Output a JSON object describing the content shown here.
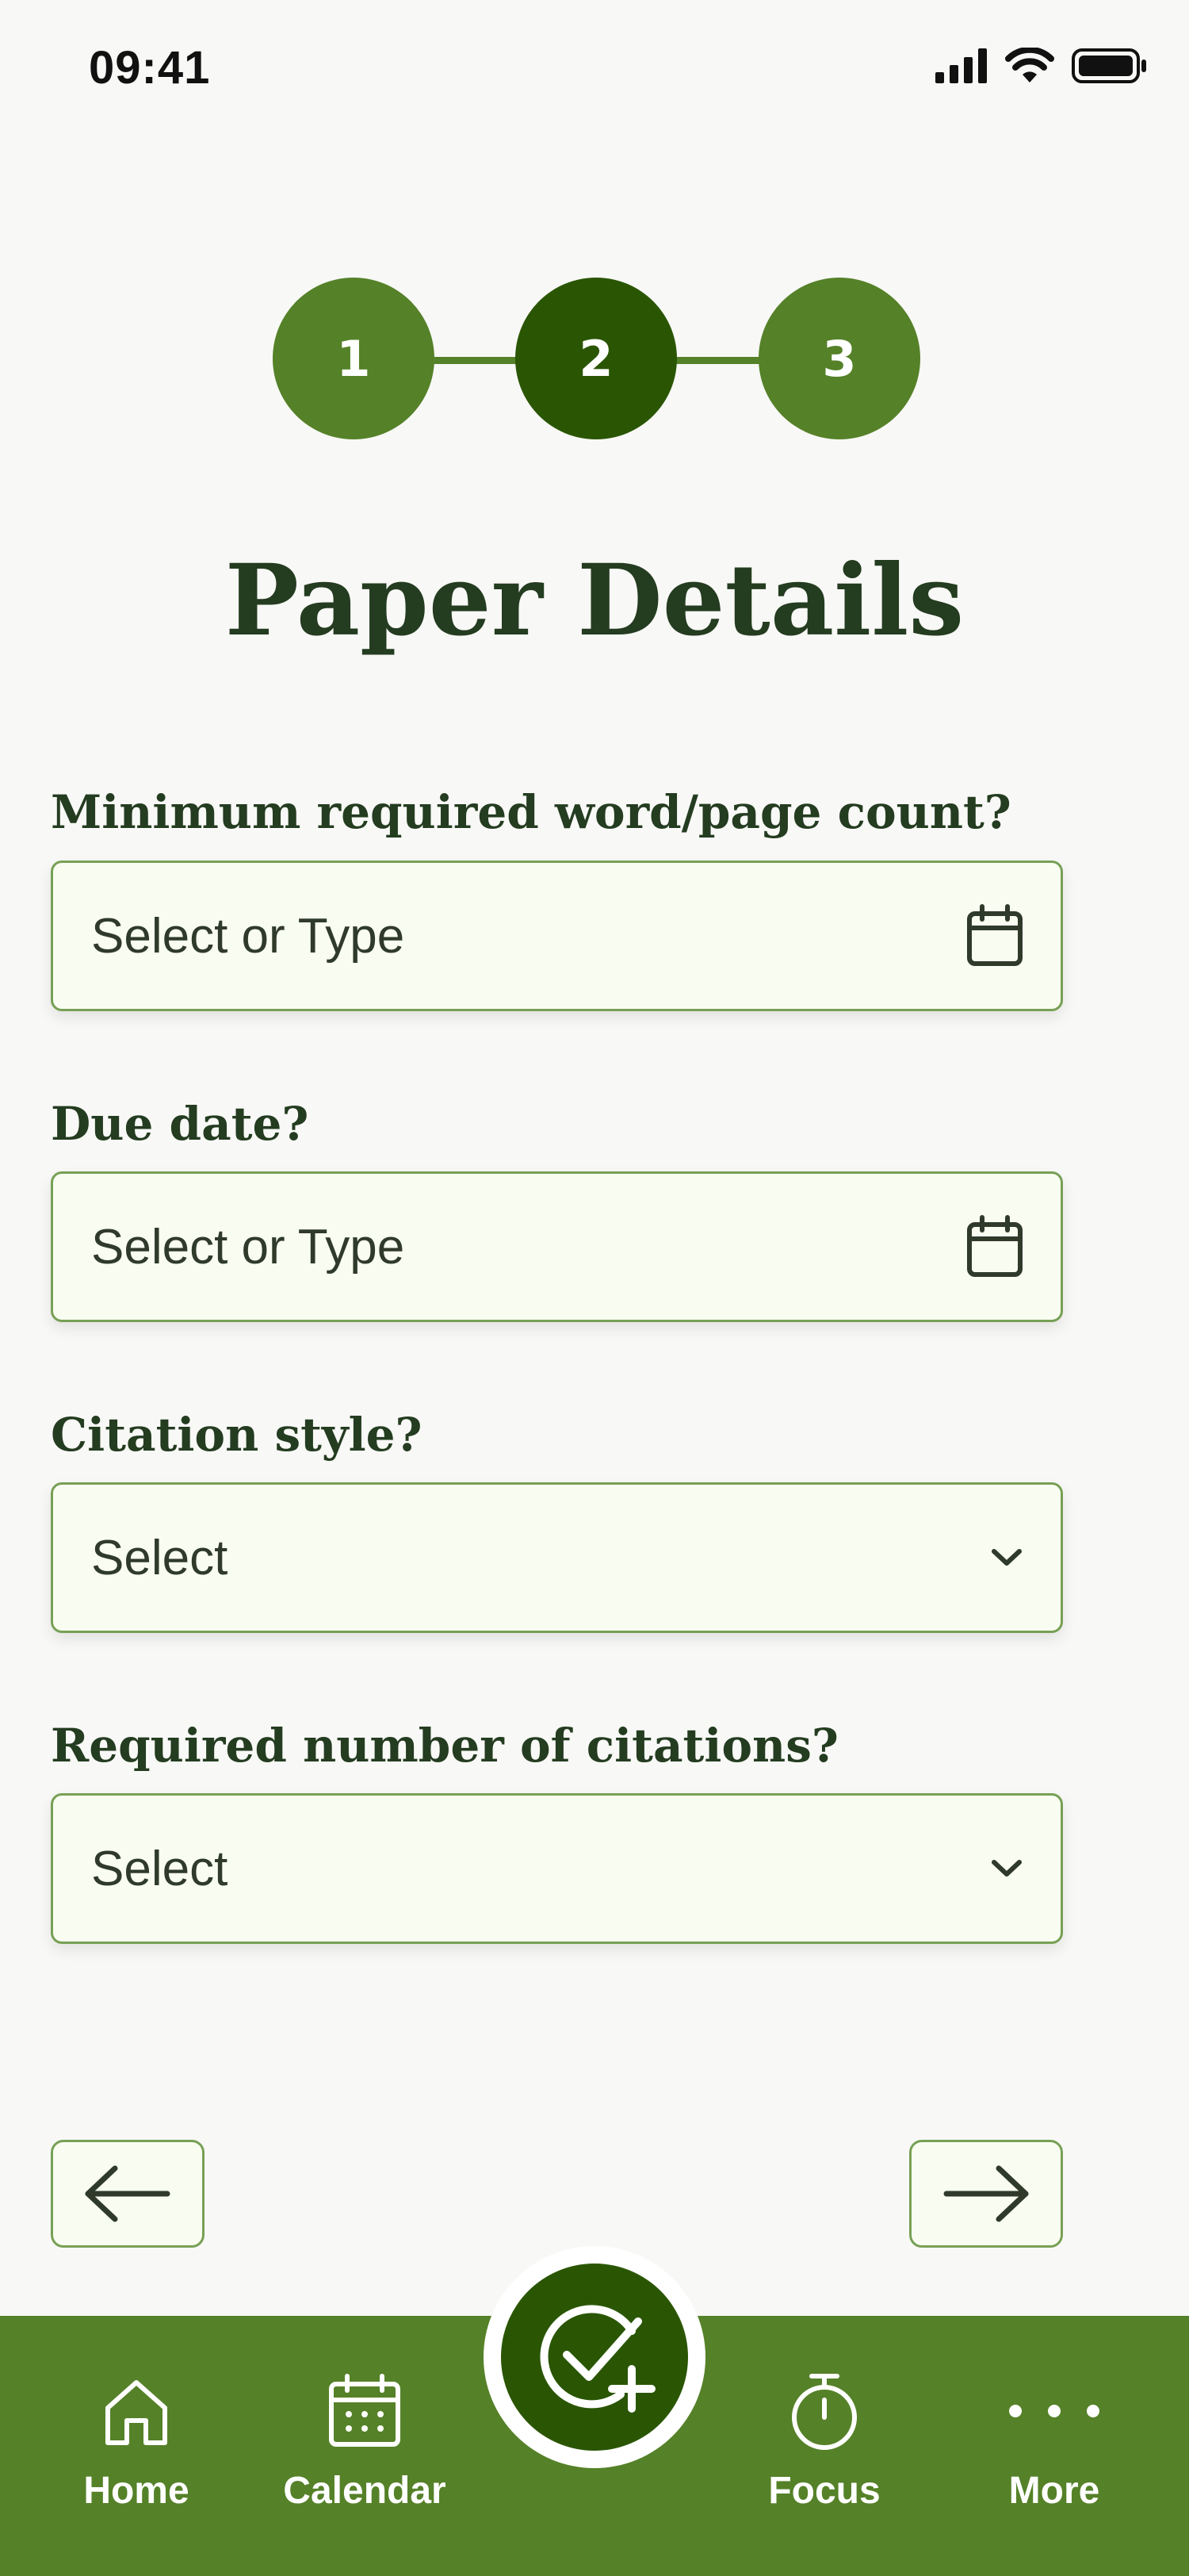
{
  "status_bar": {
    "time": "09:41"
  },
  "stepper": {
    "steps": [
      "1",
      "2",
      "3"
    ],
    "active_index": 1
  },
  "page": {
    "title": "Paper Details"
  },
  "form": {
    "word_count": {
      "label": "Minimum required word/page count?",
      "value": "Select or Type",
      "icon": "calendar-icon"
    },
    "due_date": {
      "label": "Due date?",
      "value": "Select or Type",
      "icon": "calendar-icon"
    },
    "citation_style": {
      "label": "Citation style?",
      "value": "Select",
      "icon": "chevron-down-icon"
    },
    "citation_count": {
      "label": "Required number of citations?",
      "value": "Select",
      "icon": "chevron-down-icon"
    }
  },
  "navigation": {
    "back_icon": "arrow-left-icon",
    "next_icon": "arrow-right-icon"
  },
  "tab_bar": {
    "items": [
      {
        "label": "Home",
        "icon": "home-icon"
      },
      {
        "label": "Calendar",
        "icon": "calendar-icon"
      },
      {
        "label": "Focus",
        "icon": "stopwatch-icon"
      },
      {
        "label": "More",
        "icon": "more-dots-icon"
      }
    ],
    "fab_icon": "check-add-icon"
  },
  "colors": {
    "primary": "#558128",
    "primary_dark": "#2a5604",
    "field_bg": "#f9fdf1",
    "field_border": "#77a055",
    "title_text": "#243c20",
    "background": "#f8f8f6"
  }
}
